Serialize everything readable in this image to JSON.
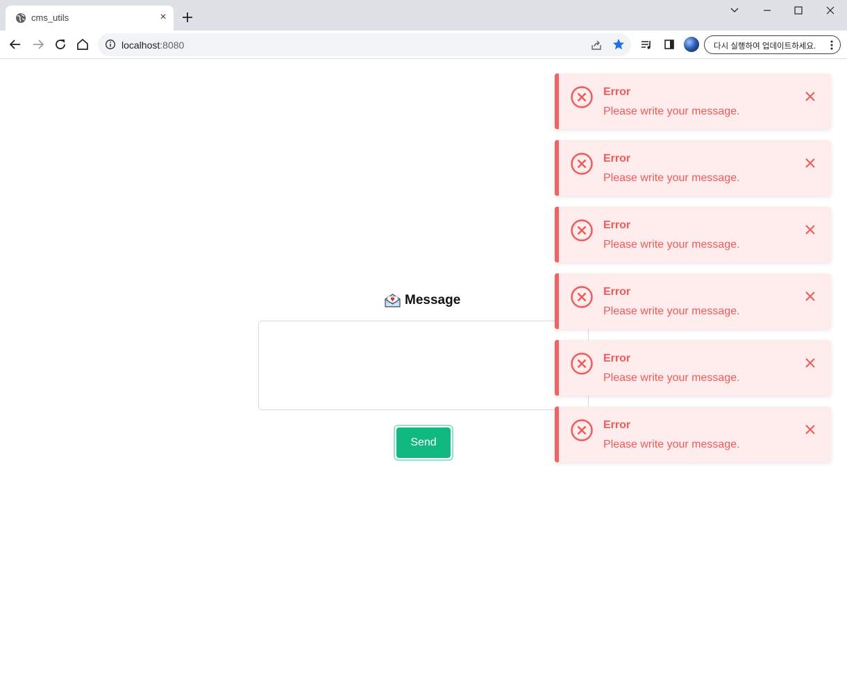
{
  "browser": {
    "tab_title": "cms_utils",
    "tab_close": "×",
    "url_host": "localhost",
    "url_port": ":8080",
    "update_button": "다시 실행하여 업데이트하세요."
  },
  "page": {
    "heading": "Message",
    "message_value": "",
    "send_label": "Send"
  },
  "colors": {
    "accent_green": "#11b981",
    "error_red": "#f05a5a",
    "error_bg": "#ffecec"
  },
  "toasts": [
    {
      "title": "Error",
      "message": "Please write your message."
    },
    {
      "title": "Error",
      "message": "Please write your message."
    },
    {
      "title": "Error",
      "message": "Please write your message."
    },
    {
      "title": "Error",
      "message": "Please write your message."
    },
    {
      "title": "Error",
      "message": "Please write your message."
    },
    {
      "title": "Error",
      "message": "Please write your message."
    }
  ]
}
